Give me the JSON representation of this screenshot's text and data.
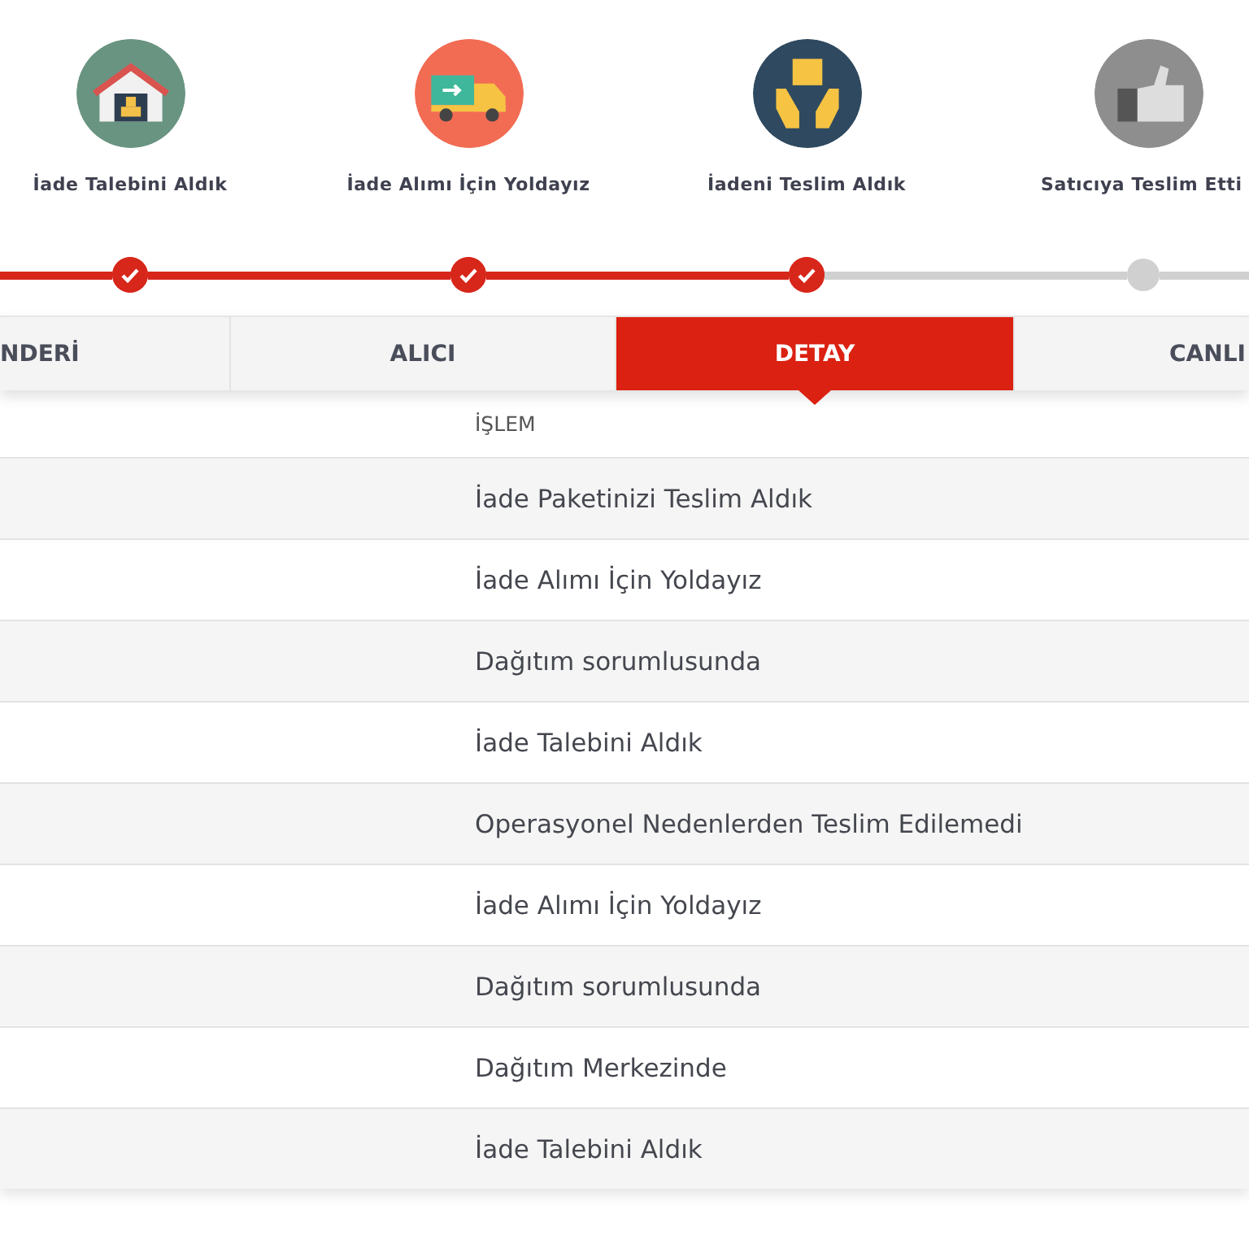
{
  "steps": [
    {
      "label": "İade Talebini Aldık",
      "kind": "warehouse",
      "color": "#6a9482",
      "done": true
    },
    {
      "label": "İade Alımı İçin Yoldayız",
      "kind": "truck",
      "color": "#f26c54",
      "done": true
    },
    {
      "label": "İadeni Teslim Aldık",
      "kind": "hands",
      "color": "#2f4a60",
      "done": true
    },
    {
      "label": "Satıcıya Teslim Etti",
      "kind": "thumb",
      "color": "#8e8e8e",
      "done": false
    }
  ],
  "tabs": [
    {
      "label": "NDERİ",
      "selected": false
    },
    {
      "label": "ALICI",
      "selected": false
    },
    {
      "label": "DETAY",
      "selected": true
    },
    {
      "label": "CANLI",
      "selected": false
    }
  ],
  "table": {
    "columns": [
      "İŞLEM"
    ],
    "rows": [
      "İade Paketinizi Teslim Aldık",
      "İade Alımı İçin Yoldayız",
      "Dağıtım sorumlusunda",
      "İade Talebini Aldık",
      "Operasyonel Nedenlerden Teslim Edilemedi",
      "İade Alımı İçin Yoldayız",
      "Dağıtım sorumlusunda",
      "Dağıtım Merkezinde",
      "İade Talebini Aldık"
    ]
  }
}
